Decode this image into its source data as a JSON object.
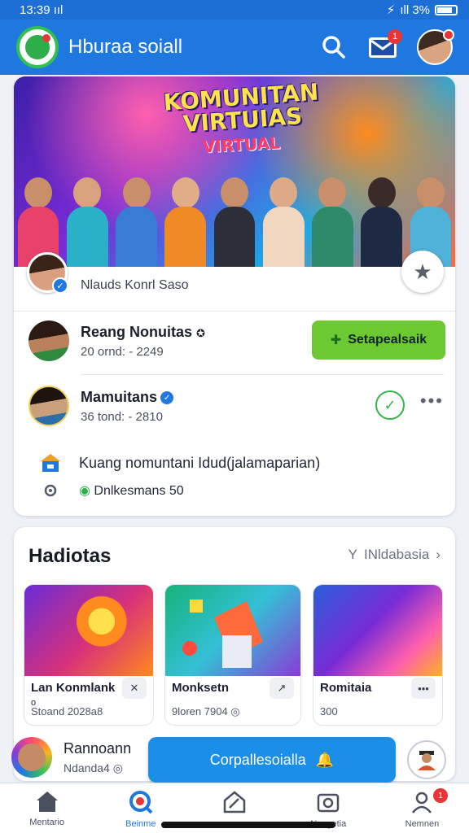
{
  "status": {
    "time": "13:39",
    "signal_left": "ııl",
    "right_text": "ıll 3%"
  },
  "app": {
    "title": "Hburaa soiall",
    "notif_count": "1"
  },
  "hero": {
    "title": "KOMUNITAN VIRTUIAS",
    "subtitle": "VIRTUAL",
    "caption": "Nlauds Konrl Saso"
  },
  "members": [
    {
      "name": "Reang Nonuitas",
      "meta": "20 ornd: - 2249",
      "button": "Setapealsaik"
    },
    {
      "name": "Mamuitans",
      "meta": "36 tond: - 2810"
    }
  ],
  "info": {
    "line1": "Kuang nomuntani Idud(jalamaparian)",
    "line2": "Dnlkesmans 50"
  },
  "activities": {
    "title": "Hadiotas",
    "link": "INldabasia",
    "link_prefix": "Y",
    "tiles": [
      {
        "name": "Lan Konmlank",
        "sub": "o",
        "meta": "Stoand 2028a8",
        "btn": "✕"
      },
      {
        "name": "Monksetn",
        "meta": "9loren 7904 ◎",
        "btn": "↗"
      },
      {
        "name": "Romitaia",
        "meta": "300",
        "btn": "•••"
      }
    ]
  },
  "post": {
    "name": "Rannoann",
    "meta": "Ndanda4 ◎",
    "cta": "Corpallesoialla"
  },
  "nav": [
    {
      "label": "Mentario"
    },
    {
      "label": "Beinme"
    },
    {
      "label": ""
    },
    {
      "label": "Neagetia"
    },
    {
      "label": "Nemnen",
      "badge": "1"
    }
  ]
}
